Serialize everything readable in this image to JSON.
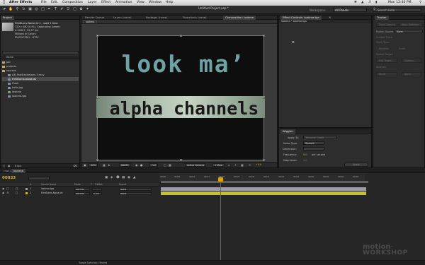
{
  "menubar": {
    "app": "After Effects",
    "items": [
      "File",
      "Edit",
      "Composition",
      "Layer",
      "Effect",
      "Animation",
      "View",
      "Window",
      "Help"
    ],
    "clock": "Mon 12:40 PM",
    "search_icon": "spotlight-icon"
  },
  "toolbar": {
    "doc_title": "Untitled Project.aep *",
    "workspace_label": "Workspace:",
    "workspace_value": "All Panels",
    "search_placeholder": "Search Help"
  },
  "project": {
    "tab": "Project",
    "selected_name": "FilmBurns-Noise.dv ▾ , used 1 time",
    "info_lines": [
      "720 x 480 (0.91), Separating (lower)",
      "Δ 00067, 29.97 fps",
      "Millions of Colors",
      "DV/DVCPRO - NTSC"
    ],
    "column": "Name",
    "items": [
      {
        "name": "pal",
        "type": "folder",
        "selected": false
      },
      {
        "name": "projects",
        "type": "folder",
        "selected": false
      },
      {
        "name": "sources",
        "type": "folder",
        "selected": false
      },
      {
        "name": "AB_FastExplosions-3.mov",
        "type": "footage",
        "selected": false
      },
      {
        "name": "FilmBurns-Noise.dv",
        "type": "footage",
        "selected": true
      },
      {
        "name": "Flash",
        "type": "footage",
        "selected": false
      },
      {
        "name": "hello.jpg",
        "type": "footage",
        "selected": false
      },
      {
        "name": "lookma",
        "type": "comp",
        "selected": false
      },
      {
        "name": "lookma.tga",
        "type": "footage",
        "selected": false
      }
    ],
    "footer": "8 bpc"
  },
  "comp": {
    "tabs": [
      "Render Queue",
      "Layer: (none)",
      "Footage: (none)",
      "Flowchart: (none)",
      "Composition: lookma"
    ],
    "active_tab": "Composition: lookma",
    "crumb": "lookma",
    "title_line1": "look ma’",
    "title_line2": "alpha channels",
    "footer": {
      "zoom": "50%",
      "timecode": "00033",
      "resolution": "Full",
      "camera": "Active Camera",
      "views": "1 View",
      "exposure": "+0.0"
    }
  },
  "effect_controls": {
    "tab": "Effect Controls: lookma.tga",
    "subheader": "lookma • lookma.tga"
  },
  "wiggler": {
    "tab": "Wiggler",
    "apply_to_label": "Apply To:",
    "apply_to_value": "Temporal Graph",
    "noise_type_label": "Noise Type:",
    "noise_type_value": "Smooth",
    "dimension_label": "Dimension:",
    "frequency_label": "Frequency:",
    "frequency_value": "5.0",
    "frequency_unit": "per second",
    "magnitude_label": "Magnitude:",
    "magnitude_value": "1.0",
    "apply_button": "Apply"
  },
  "tracker": {
    "tab": "Tracker",
    "buttons_top": [
      "Track Camera",
      "Warp Stabilizer"
    ],
    "motion_source_label": "Motion Source:",
    "motion_source_value": "None",
    "buttons_mid": [
      "Current Track:",
      "Track Type:",
      "Rotation",
      "Scale",
      "Motion Target:"
    ],
    "buttons_bottom": [
      "Edit Target...",
      "Options...",
      "Analyze:",
      "Reset",
      "Apply"
    ]
  },
  "timeline": {
    "tabs": [
      "(null)",
      "lookma"
    ],
    "timecode": "00033",
    "headers": {
      "num": "#",
      "source": "Source Name",
      "mode": "Mode",
      "t": "T",
      "trkmat": "TrkMat",
      "parent": "Parent"
    },
    "layers": [
      {
        "num": "1",
        "name": "lookma.tga",
        "mode": "Normal",
        "trkmat": "",
        "parent": "None",
        "color": "#9b9dae"
      },
      {
        "num": "2",
        "name": "FilmBurns-Noise.dv",
        "mode": "Normal",
        "trkmat": "A.Inv",
        "parent": "None",
        "color": "#c6c22b"
      }
    ],
    "ruler_ticks": [
      "00000",
      "00005",
      "00010",
      "00015",
      "00020",
      "00025",
      "00030",
      "00035",
      "00040",
      "00045",
      "00050",
      "00055",
      "00060",
      "00065"
    ],
    "footer": "Toggle Switches / Modes"
  },
  "watermark": {
    "line1": "motion",
    "line2": "WORKSHOP",
    "mark": "™"
  }
}
